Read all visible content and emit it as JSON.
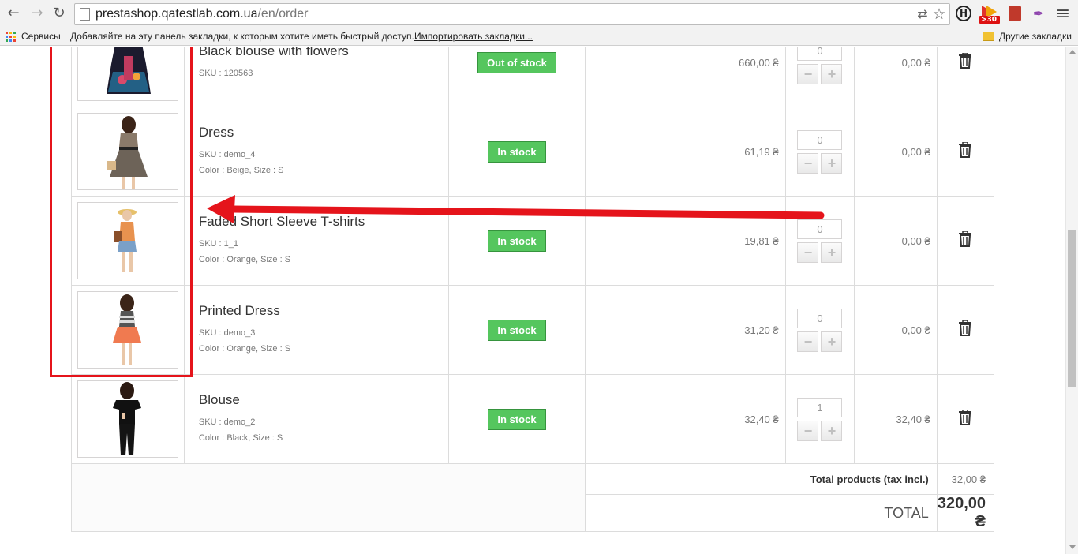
{
  "browser": {
    "url_host": "prestashop.qatestlab.com.ua",
    "url_path": "/en/order",
    "nav": {
      "back": "←",
      "forward": "→",
      "reload": "↻"
    },
    "extensions": [
      {
        "name": "translate-icon",
        "glyph": "⇄"
      },
      {
        "name": "star-icon",
        "glyph": "☆"
      },
      {
        "name": "h-extension-icon",
        "glyph": "H"
      },
      {
        "name": "extension-badge-icon",
        "glyph": ">30"
      },
      {
        "name": "bookmark-extension-icon",
        "glyph": "■"
      },
      {
        "name": "feather-extension-icon",
        "glyph": "✒"
      },
      {
        "name": "menu-icon",
        "glyph": "≡"
      }
    ]
  },
  "bookmarks_bar": {
    "apps_label": "Сервисы",
    "hint": "Добавляйте на эту панель закладки, к которым хотите иметь быстрый доступ.",
    "import_link": "Импортировать закладки...",
    "other_bookmarks": "Другие закладки"
  },
  "cart": {
    "rows": [
      {
        "name": "Black blouse with flowers",
        "sku": "SKU : 120563",
        "attrs": "",
        "availability": "Out of stock",
        "unit_price": "660,00 ₴",
        "qty": "0",
        "total": "0,00 ₴"
      },
      {
        "name": "Dress",
        "sku": "SKU : demo_4",
        "attrs": "Color : Beige, Size : S",
        "availability": "In stock",
        "unit_price": "61,19 ₴",
        "qty": "0",
        "total": "0,00 ₴"
      },
      {
        "name": "Faded Short Sleeve T-shirts",
        "sku": "SKU : 1_1",
        "attrs": "Color : Orange, Size : S",
        "availability": "In stock",
        "unit_price": "19,81 ₴",
        "qty": "0",
        "total": "0,00 ₴"
      },
      {
        "name": "Printed Dress",
        "sku": "SKU : demo_3",
        "attrs": "Color : Orange, Size : S",
        "availability": "In stock",
        "unit_price": "31,20 ₴",
        "qty": "0",
        "total": "0,00 ₴"
      },
      {
        "name": "Blouse",
        "sku": "SKU : demo_2",
        "attrs": "Color : Black, Size : S",
        "availability": "In stock",
        "unit_price": "32,40 ₴",
        "qty": "1",
        "total": "32,40 ₴"
      }
    ],
    "qty_minus": "−",
    "qty_plus": "+",
    "total_products_label": "Total products (tax incl.)",
    "total_products_value": "32,00 ₴",
    "total_label": "TOTAL",
    "total_value": "320,00 ₴"
  },
  "colors": {
    "in_stock": "#55c65e",
    "annotation": "#e5141b"
  }
}
